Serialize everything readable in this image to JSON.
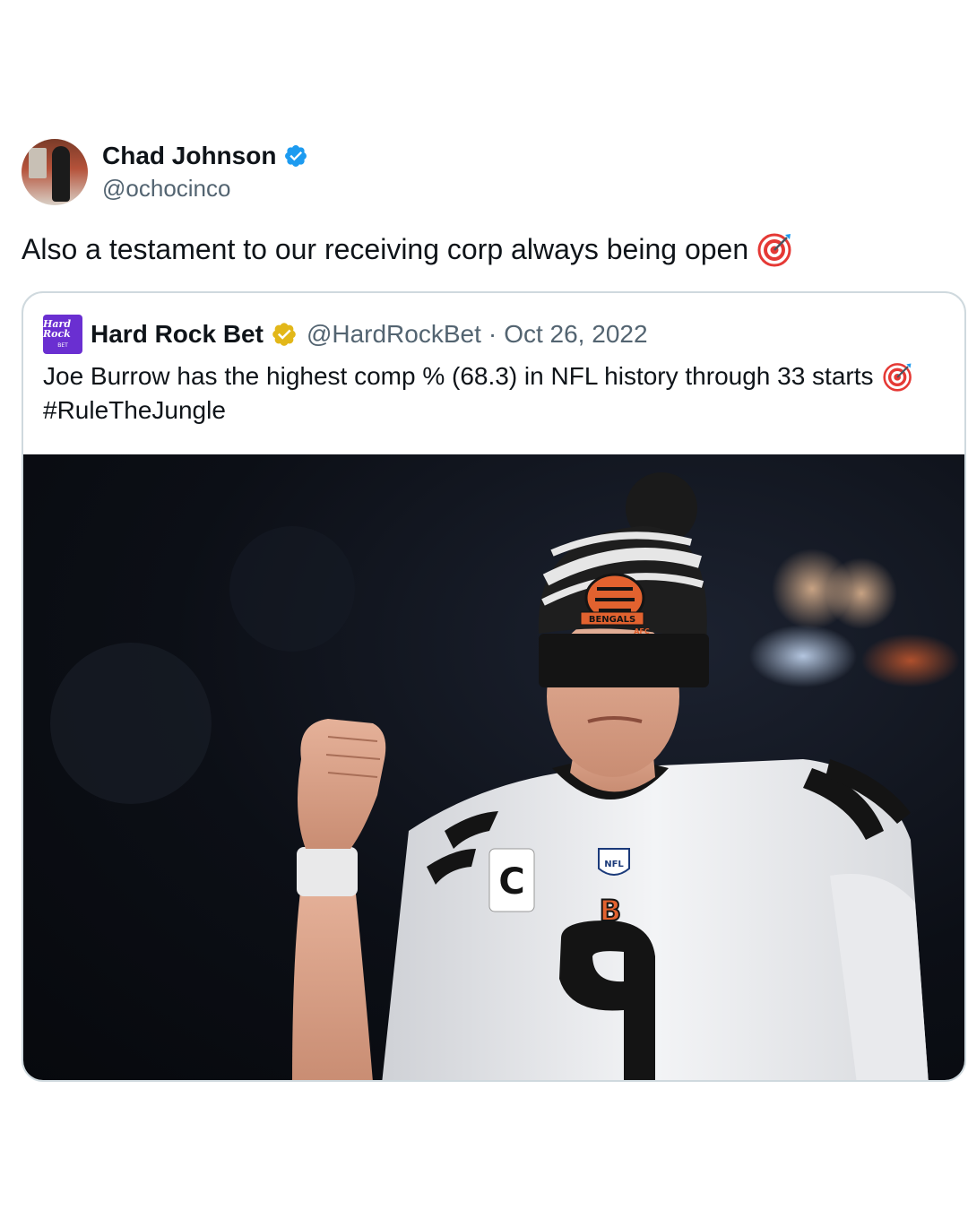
{
  "tweet": {
    "author_name": "Chad Johnson",
    "author_handle": "@ochocinco",
    "text": "Also a testament to our receiving corp always being open",
    "text_emoji": "target-icon"
  },
  "quote": {
    "author_name": "Hard Rock Bet",
    "author_handle": "@HardRockBet",
    "separator": "·",
    "date": "Oct 26, 2022",
    "text_line1": "Joe Burrow has the highest comp % (68.3) in NFL history through 33 starts",
    "text_line2": "#RuleTheJungle",
    "logo_line1": "Hard Rock",
    "logo_line2": "BET",
    "photo_icon": "player-photo",
    "hat_text": "BENGALS",
    "hat_text2": "AFC",
    "jersey_number": "9",
    "jersey_letter": "C",
    "jersey_logo": "NFL"
  },
  "colors": {
    "verified_blue": "#1d9bf0",
    "verified_gold": "#e2b719",
    "handle_gray": "#536471",
    "card_border": "#cfd9de"
  }
}
